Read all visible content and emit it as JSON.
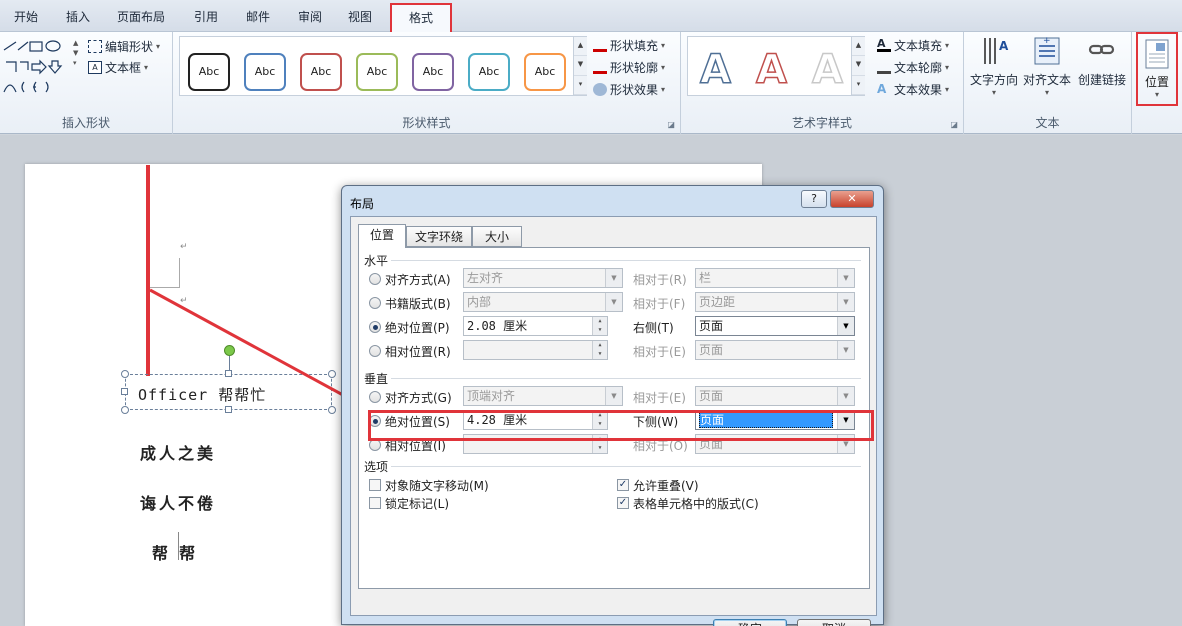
{
  "tabs": [
    {
      "label": "开始"
    },
    {
      "label": "插入"
    },
    {
      "label": "页面布局"
    },
    {
      "label": "引用"
    },
    {
      "label": "邮件"
    },
    {
      "label": "审阅"
    },
    {
      "label": "视图"
    },
    {
      "label": "格式"
    }
  ],
  "ribbon": {
    "insert_shapes": {
      "label": "插入形状",
      "edit_shape": "编辑形状",
      "text_box": "文本框"
    },
    "shape_styles": {
      "label": "形状样式",
      "sample": "Abc",
      "fill": "形状填充",
      "outline": "形状轮廓",
      "effects": "形状效果"
    },
    "wordart": {
      "label": "艺术字样式",
      "sample": "A",
      "text_fill": "文本填充",
      "text_outline": "文本轮廓",
      "text_effects": "文本效果"
    },
    "text": {
      "label": "文本",
      "direction": "文字方向",
      "align": "对齐文本",
      "link": "创建链接"
    },
    "position": {
      "label": "位置"
    }
  },
  "document": {
    "line1": "Officer 帮帮忙",
    "line2": "成人之美",
    "line3": "诲人不倦",
    "line4": "帮  帮"
  },
  "dialog": {
    "title": "布局",
    "help": "?",
    "close": "✕",
    "tabs": [
      {
        "label": "位置"
      },
      {
        "label": "文字环绕"
      },
      {
        "label": "大小"
      }
    ],
    "horizontal": {
      "title": "水平",
      "alignment": {
        "label": "对齐方式(A)",
        "value": "左对齐",
        "rel_label": "相对于(R)",
        "rel_value": "栏"
      },
      "book_layout": {
        "label": "书籍版式(B)",
        "value": "内部",
        "rel_label": "相对于(F)",
        "rel_value": "页边距"
      },
      "absolute": {
        "label": "绝对位置(P)",
        "value": "2.08 厘米",
        "rel_label": "右侧(T)",
        "rel_value": "页面"
      },
      "relative": {
        "label": "相对位置(R)",
        "value": "",
        "rel_label": "相对于(E)",
        "rel_value": "页面"
      }
    },
    "vertical": {
      "title": "垂直",
      "alignment": {
        "label": "对齐方式(G)",
        "value": "顶端对齐",
        "rel_label": "相对于(E)",
        "rel_value": "页面"
      },
      "absolute": {
        "label": "绝对位置(S)",
        "value": "4.28 厘米",
        "rel_label": "下侧(W)",
        "rel_value": "页面"
      },
      "relative": {
        "label": "相对位置(I)",
        "value": "",
        "rel_label": "相对于(O)",
        "rel_value": "页面"
      }
    },
    "options": {
      "title": "选项",
      "move_with_text": {
        "label": "对象随文字移动(M)",
        "checked": false
      },
      "lock_anchor": {
        "label": "锁定标记(L)",
        "checked": false
      },
      "allow_overlap": {
        "label": "允许重叠(V)",
        "checked": true
      },
      "layout_in_cell": {
        "label": "表格单元格中的版式(C)",
        "checked": true
      }
    },
    "ok": "确定",
    "cancel": "取消"
  },
  "colors": {
    "highlight": "#e0343a",
    "accent": "#3c7fb1"
  }
}
